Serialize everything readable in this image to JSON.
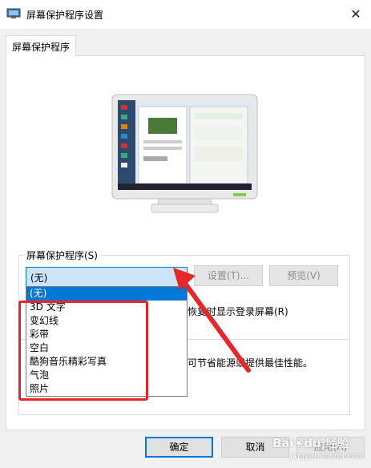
{
  "window": {
    "title": "屏幕保护程序设置",
    "close_glyph": "✕"
  },
  "tab": {
    "label": "屏幕保护程序"
  },
  "screensaver": {
    "group_label": "屏幕保护程序(S)",
    "selected": "(无)",
    "settings_label": "设置(T)...",
    "preview_label": "预览(V)",
    "options": [
      "(无)",
      "3D 文字",
      "变幻线",
      "彩带",
      "空白",
      "酷狗音乐精彩写真",
      "气泡",
      "照片"
    ],
    "resume_text_partial": "恢复时显示登录屏幕(R)"
  },
  "power": {
    "text_partial": "可节省能源或提供最佳性能。"
  },
  "footer": {
    "ok_label": "确定",
    "cancel_label": "取消",
    "apply_label": "应用(A)"
  },
  "annotation": {
    "color": "#e8262a"
  },
  "watermark": {
    "logo": "Bai du 经验",
    "sub": "jingyan.baidu.com"
  },
  "colors": {
    "accent": "#0078d7",
    "selection_bg": "#cce4f7",
    "highlight": "#e8262a"
  }
}
